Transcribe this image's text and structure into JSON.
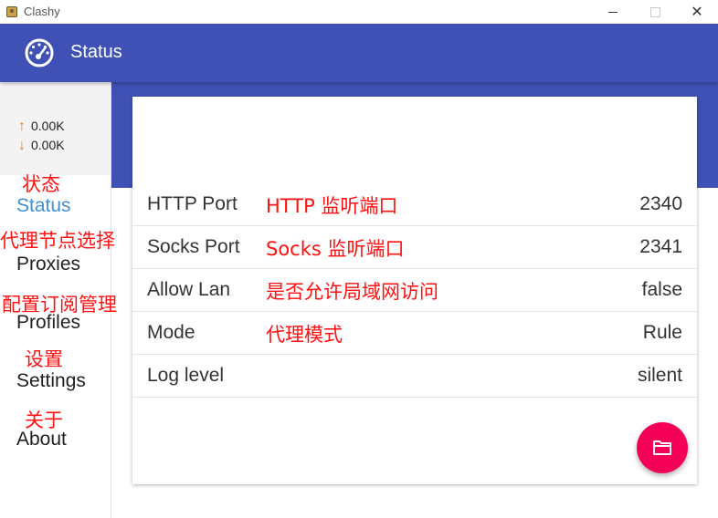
{
  "window": {
    "title": "Clashy",
    "minimize_icon": "minimize-icon",
    "maximize_icon": "maximize-icon",
    "close_icon": "close-icon",
    "close_glyph": "✕"
  },
  "appbar": {
    "title": "Status",
    "icon": "speedometer-icon"
  },
  "traffic": {
    "up": "0.00K",
    "down": "0.00K",
    "up_arrow": "↑",
    "down_arrow": "↓"
  },
  "nav": {
    "items": [
      {
        "label": "Status",
        "annotation": "状态",
        "active": true
      },
      {
        "label": "Proxies",
        "annotation": "代理节点选择"
      },
      {
        "label": "Profiles",
        "annotation": "配置订阅管理"
      },
      {
        "label": "Settings",
        "annotation": "设置"
      },
      {
        "label": "About",
        "annotation": "关于"
      }
    ]
  },
  "status": {
    "rows": [
      {
        "label": "HTTP Port",
        "annotation": "HTTP 监听端口",
        "value": "2340"
      },
      {
        "label": "Socks Port",
        "annotation": "Socks 监听端口",
        "value": "2341"
      },
      {
        "label": "Allow Lan",
        "annotation": "是否允许局域网访问",
        "value": "false"
      },
      {
        "label": "Mode",
        "annotation": "代理模式",
        "value": "Rule"
      },
      {
        "label": "Log level",
        "annotation": "",
        "value": "silent"
      }
    ]
  },
  "fab": {
    "icon": "folder-icon"
  },
  "colors": {
    "primary": "#3f51b5",
    "accent": "#f50057",
    "active_nav": "#3f8fd2",
    "annotation": "#ff0f0f",
    "arrow": "#e8842f"
  }
}
